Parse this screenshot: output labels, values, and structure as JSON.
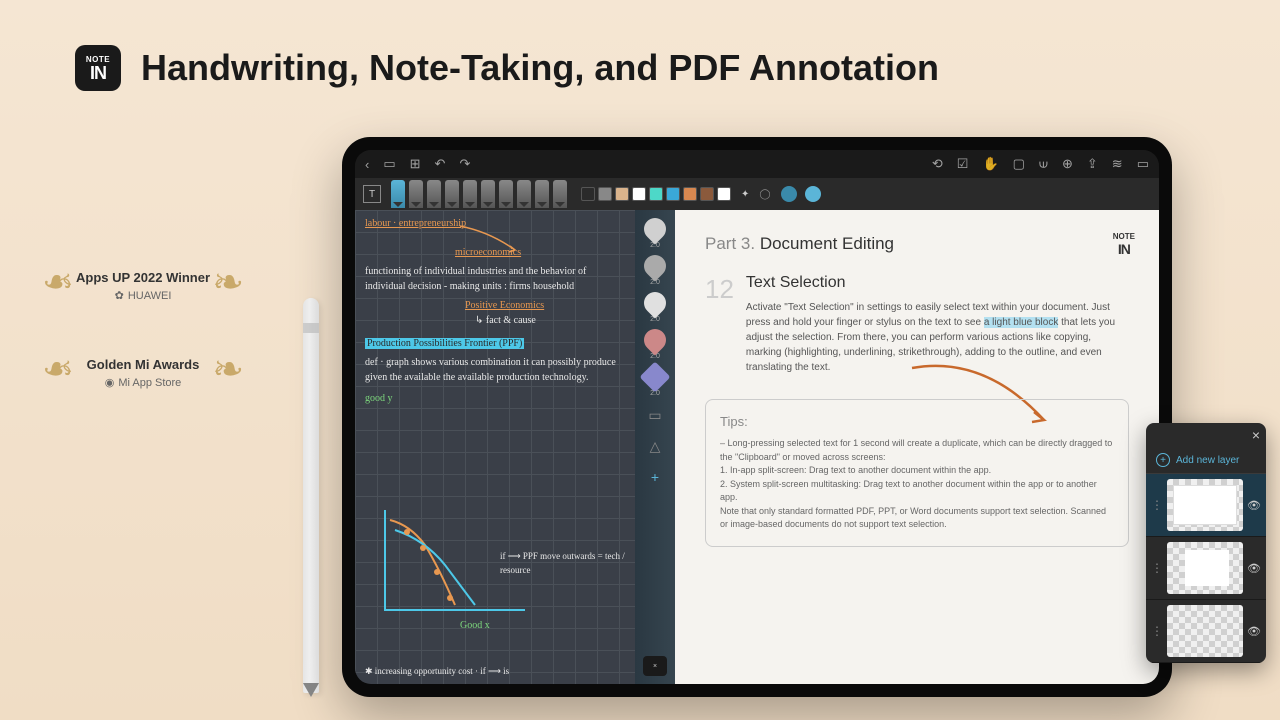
{
  "app_icon": {
    "top": "NOTE",
    "bottom": "IN"
  },
  "headline": "Handwriting, Note-Taking, and PDF Annotation",
  "awards": [
    {
      "title": "Apps UP 2022 Winner",
      "sub": "HUAWEI"
    },
    {
      "title": "Golden Mi Awards",
      "sub": "Mi App Store"
    }
  ],
  "toolbar_icons": {
    "back": "‹",
    "view1": "▭",
    "view2": "⊞",
    "undo": "↶",
    "redo": "↷",
    "refresh": "⟲",
    "check": "☑",
    "hand": "✋",
    "image": "▢",
    "crop": "⟒",
    "add": "⊕",
    "share": "⇪",
    "layers": "≋",
    "more": "▭"
  },
  "penrow": {
    "text_tool": "T",
    "swatches": [
      "#2a2a2a",
      "#888888",
      "#d9b38c",
      "#ffffff",
      "#4dd8c8",
      "#3aa8d8",
      "#d88850",
      "#8b5a3c",
      "#ffffff"
    ],
    "size_label": "2.0"
  },
  "notes": {
    "line1": "labour · entrepreneurship",
    "micro": "microeconomics",
    "body1": "functioning of individual industries and the behavior of individual decision - making units : firms household",
    "positive": "Positive Economics",
    "fact": "↳ fact & cause",
    "ppf": "Production Possibilities Frontier (PPF)",
    "def": "def · graph shows various combination it can possibly produce given the available the available production technology.",
    "goody": "good y",
    "ppf_note": "if ⟶ PPF move outwards = tech / resource",
    "goodx": "Good x",
    "bottom": "✱ increasing opportunity cost · if ⟶ is"
  },
  "pensidebar": {
    "labels": [
      "2.0",
      "2.0",
      "2.0",
      "2.0",
      "2.0",
      "2.0",
      "2.0"
    ]
  },
  "doc": {
    "logo_top": "NOTE",
    "logo_bottom": "IN",
    "part_label": "Part 3.",
    "part_title": "Document Editing",
    "section_num": "12",
    "section_title": "Text Selection",
    "body_pre": "Activate \"Text Selection\" in settings to easily select text within your document. Just press and hold your finger or stylus on the text to see ",
    "body_hl": "a light blue block",
    "body_post": " that lets you adjust the selection. From there, you can perform various actions like copying, marking (highlighting, underlining, strikethrough), adding to the outline, and even translating the text.",
    "tips_title": "Tips:",
    "tips_body": "– Long-pressing selected text for 1 second will create a duplicate, which can be directly dragged to the \"Clipboard\" or moved across screens:\n1. In-app split-screen: Drag text to another document within the app.\n2. System split-screen multitasking: Drag text to another document within the app or to another app.\nNote that only standard formatted PDF, PPT, or Word documents support text selection. Scanned or image-based documents do not support text selection."
  },
  "layers": {
    "add_label": "Add new layer",
    "close": "×"
  }
}
